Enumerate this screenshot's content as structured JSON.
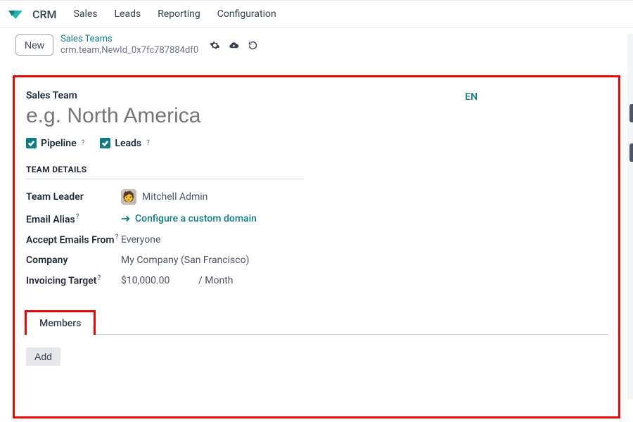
{
  "header": {
    "app_name": "CRM",
    "nav": [
      "Sales",
      "Leads",
      "Reporting",
      "Configuration"
    ]
  },
  "subbar": {
    "new_label": "New",
    "breadcrumb_top": "Sales Teams",
    "breadcrumb_bottom": "crm.team,NewId_0x7fc787884df0",
    "icons": {
      "gear": "gear-icon",
      "cloud": "cloud-upload-icon",
      "undo": "undo-icon"
    }
  },
  "form": {
    "lang": "EN",
    "title_label": "Sales Team",
    "title_placeholder": "e.g. North America",
    "pipeline": {
      "label": "Pipeline",
      "checked": true
    },
    "leads": {
      "label": "Leads",
      "checked": true
    },
    "section_header": "TEAM DETAILS",
    "team_leader": {
      "label": "Team Leader",
      "value": "Mitchell Admin"
    },
    "email_alias": {
      "label": "Email Alias",
      "action": "Configure a custom domain"
    },
    "accept_from": {
      "label": "Accept Emails From",
      "value": "Everyone"
    },
    "company": {
      "label": "Company",
      "value": "My Company (San Francisco)"
    },
    "invoicing": {
      "label": "Invoicing Target",
      "value": "$10,000.00",
      "unit": "/ Month"
    },
    "tabs": {
      "members": "Members"
    },
    "add_label": "Add"
  }
}
